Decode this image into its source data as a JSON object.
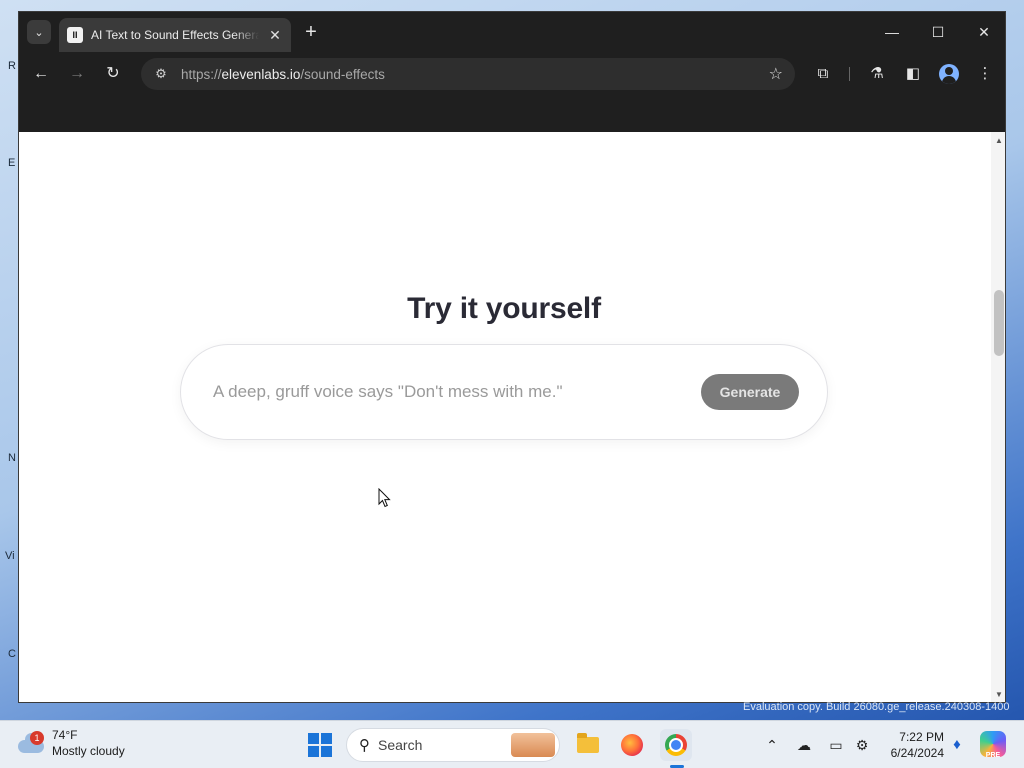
{
  "desktop": {
    "edge_glyphs": [
      "R",
      "E",
      "N",
      "Vi",
      "C"
    ]
  },
  "browser": {
    "tab": {
      "favicon": "II",
      "title": "AI Text to Sound Effects Generator",
      "close_icon": "✕"
    },
    "new_tab_icon": "+",
    "tab_search_icon": "⌄",
    "window_controls": {
      "minimize": "—",
      "maximize": "☐",
      "close": "✕"
    },
    "toolbar": {
      "back_icon": "←",
      "forward_icon": "→",
      "reload_icon": "↻",
      "site_info_icon": "⚙",
      "url_prefix": "https://",
      "url_host": "elevenlabs.io",
      "url_path": "/sound-effects",
      "bookmark_icon": "☆",
      "extensions_icon": "⧉",
      "labs_icon": "⚗",
      "side_panel_icon": "◧",
      "menu_icon": "⋮"
    }
  },
  "page": {
    "heading": "Try it yourself",
    "prompt": {
      "placeholder": "A deep, gruff voice says \"Don't mess with me.\"",
      "value": ""
    },
    "generate_button": "Generate"
  },
  "os": {
    "watermark": "Evaluation copy. Build 26080.ge_release.240308-1400",
    "weather": {
      "badge": "1",
      "temp": "74°F",
      "condition": "Mostly cloudy"
    },
    "search_label": "Search",
    "tray": {
      "chevron_icon": "⌃",
      "cloud_off_icon": "☁",
      "display_icon": "▭",
      "network_icon": "⚙"
    },
    "clock": {
      "time": "7:22 PM",
      "date": "6/24/2024"
    },
    "bell_icon": "🔔",
    "copilot_label": "PRE"
  },
  "colors": {
    "generate_bg": "#7a7a7a",
    "browser_chrome": "#1f1f1f",
    "accent_blue": "#1b74d8"
  }
}
